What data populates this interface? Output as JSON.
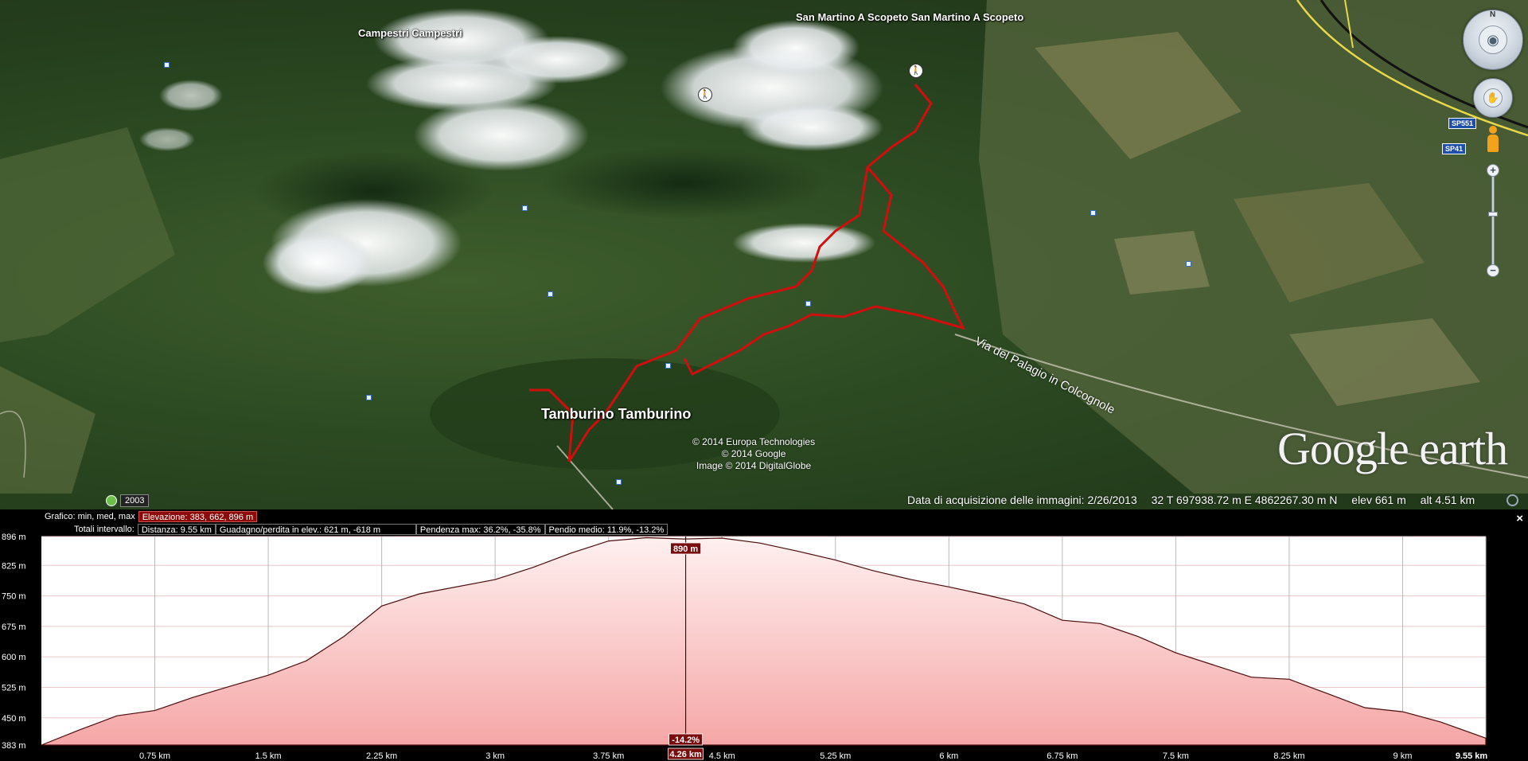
{
  "map": {
    "places": [
      {
        "name": "Campestri  Campestri"
      },
      {
        "name": "San Martino A Scopeto  San Martino A Scopeto"
      },
      {
        "name": "Tamburino  Tamburino"
      }
    ],
    "road_label": "Via del Palagio in Colcognole",
    "road_shields": [
      "SP551",
      "SP41"
    ],
    "copyright_lines": [
      "© 2014 Europa Technologies",
      "© 2014 Google",
      "Image © 2014 DigitalGlobe"
    ],
    "logo_text": "Google earth",
    "historical_year": "2003",
    "compass_label": "N",
    "status": {
      "imagery_date": "Data di acquisizione delle immagini: 2/26/2013",
      "coordinates": "32 T 697938.72 m E 4862267.30 m N",
      "elevation": "elev   661 m",
      "altitude": "alt   4.51 km"
    },
    "colors": {
      "track": "#d10e0e",
      "profile_fill_top": "#ffdada",
      "profile_fill_bottom": "#f5a6a6"
    }
  },
  "profile": {
    "graph_label": "Grafico: min, med, max",
    "elevation_stats": "Elevazione: 383, 662, 896 m",
    "totals_label": "Totali intervallo:",
    "distance": "Distanza: 9.55 km",
    "gain_loss": "Guadagno/perdita in elev.: 621 m, -618 m",
    "max_slope": "Pendenza max: 36.2%, -35.8%",
    "avg_slope": "Pendio medio: 11.9%, -13.2%",
    "close_label": "×",
    "cursor": {
      "distance_label": "4.26 km",
      "elevation_label": "890 m",
      "slope_label": "-14.2%",
      "distance_km": 4.26
    }
  },
  "chart_data": {
    "type": "area",
    "xlabel": "",
    "ylabel": "",
    "xlim": [
      0,
      9.55
    ],
    "ylim": [
      383,
      896
    ],
    "y_ticks": [
      "896 m",
      "825 m",
      "750 m",
      "675 m",
      "600 m",
      "525 m",
      "450 m",
      "383 m"
    ],
    "y_tick_values": [
      896,
      825,
      750,
      675,
      600,
      525,
      450,
      383
    ],
    "x_ticks": [
      "0.75 km",
      "1.5 km",
      "2.25 km",
      "3 km",
      "3.75 km",
      "4.5 km",
      "5.25 km",
      "6 km",
      "6.75 km",
      "7.5 km",
      "8.25 km",
      "9 km",
      "9.55 km"
    ],
    "x_tick_values": [
      0.75,
      1.5,
      2.25,
      3,
      3.75,
      4.5,
      5.25,
      6,
      6.75,
      7.5,
      8.25,
      9,
      9.55
    ],
    "series": [
      {
        "x": [
          0,
          0.25,
          0.5,
          0.75,
          1.0,
          1.25,
          1.5,
          1.75,
          2.0,
          2.25,
          2.5,
          3.0,
          3.25,
          3.5,
          3.75,
          4.0,
          4.25,
          4.5,
          4.75,
          5.0,
          5.25,
          5.5,
          5.75,
          6.0,
          6.25,
          6.5,
          6.75,
          7.0,
          7.25,
          7.5,
          7.75,
          8.0,
          8.25,
          8.5,
          8.75,
          9.0,
          9.25,
          9.55
        ],
        "y": [
          383,
          420,
          455,
          468,
          500,
          528,
          555,
          590,
          650,
          725,
          755,
          790,
          820,
          855,
          885,
          893,
          890,
          892,
          880,
          860,
          838,
          812,
          790,
          772,
          752,
          730,
          690,
          682,
          650,
          610,
          580,
          550,
          545,
          510,
          475,
          465,
          440,
          400
        ]
      }
    ]
  }
}
